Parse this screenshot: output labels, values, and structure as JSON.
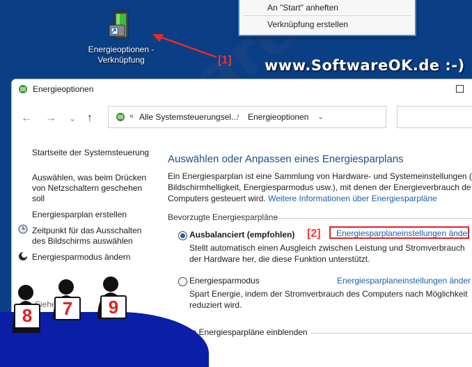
{
  "desktop": {
    "icon_label_line1": "Energieoptionen -",
    "icon_label_line2": "Verknüpfung",
    "context_menu": [
      "An \"Start\" anheften",
      "Verknüpfung erstellen"
    ],
    "marker1": "[1]",
    "marker2": "[2]",
    "watermark": "www.SoftwareOK.de :-)",
    "diagonal_watermark": "SoftwareOK.de"
  },
  "window": {
    "title": "Energieoptionen",
    "address": {
      "prefix": "«",
      "crumb1": "Alle Systemsteuerungsel...",
      "sep": "›",
      "crumb2": "Energieoptionen",
      "dropdown": "⌄"
    },
    "nav": {
      "back": "←",
      "forward": "→",
      "down": "⌄",
      "up": "↑"
    }
  },
  "sidebar": {
    "home": "Startseite der Systemsteuerung",
    "power_buttons_l1": "Auswählen, was beim Drücken",
    "power_buttons_l2": "von Netzschaltern geschehen",
    "power_buttons_l3": "soll",
    "create_plan": "Energiesparplan erstellen",
    "display_off_l1": "Zeitpunkt für das Ausschalten",
    "display_off_l2": "des Bildschirms auswählen",
    "change_mode": "Energiesparmodus ändern",
    "see_also": "Siehe",
    "more": "auto"
  },
  "main": {
    "title": "Auswählen oder Anpassen eines Energiesparplans",
    "desc_l1": "Ein Energiesparplan ist eine Sammlung von Hardware- und Systemeinstellungen (z.",
    "desc_l2": "Bildschirmhelligkeit, Energiesparmodus usw.), mit denen der Energieverbrauch de",
    "desc_l3_text": "Computers gesteuert wird.",
    "desc_l3_link": "Weitere Informationen über Energiesparpläne",
    "group_title": "Bevorzugte Energiesparpläne",
    "plans": [
      {
        "name": "Ausbalanciert (empfohlen)",
        "link": "Energiesparplaneinstellungen änder",
        "desc_l1": "Stellt automatisch einen Ausgleich zwischen Leistung und Stromverbrauch",
        "desc_l2": "der Hardware her, die diese Funktion unterstützt.",
        "selected": true
      },
      {
        "name": "Energiesparmodus",
        "link": "Energiesparplaneinstellungen änder",
        "desc_l1": "Spart Energie, indem der Stromverbrauch des Computers nach Möglichkeit",
        "desc_l2": "reduziert wird.",
        "selected": false
      }
    ],
    "more_plans": "Weitere Energiesparpläne einblenden"
  },
  "clipart": {
    "signs": [
      "8",
      "7",
      "9"
    ]
  },
  "colors": {
    "desktop": "#0a3f86",
    "link": "#1c5fb0",
    "title": "#1c4f8c",
    "marker": "#ff3030",
    "blob": "#0a1ea8"
  }
}
